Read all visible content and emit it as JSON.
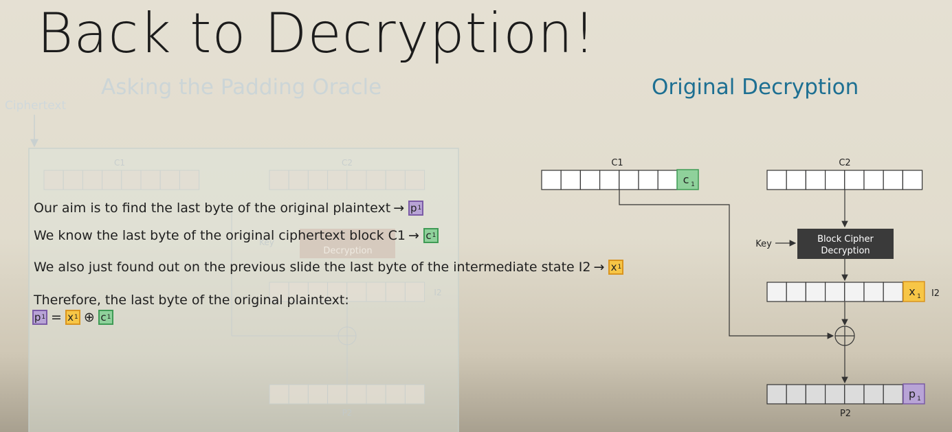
{
  "slide": {
    "title": "Back to Decryption!",
    "heading_left": "Asking the Padding Oracle",
    "heading_right": "Original Decryption",
    "ghost_label": "Ciphertext"
  },
  "ghost_diagram": {
    "c1_label": "C1",
    "c2_label": "C2",
    "key_label": "Key",
    "box_label": "Decryption",
    "i2_label": "I2",
    "p2_label": "P2"
  },
  "diagram": {
    "c1_label": "C1",
    "c2_label": "C2",
    "key_label": "Key",
    "box_line1": "Block Cipher",
    "box_line2": "Decryption",
    "i2_label": "I2",
    "p2_label": "P2",
    "c1_chip": "c",
    "x1_chip": "x",
    "p1_chip": "p",
    "chip_sub": "1",
    "colors": {
      "green_fill": "#8fd19b",
      "green_border": "#3f9b55",
      "orange_fill": "#f7c646",
      "orange_border": "#d9941e",
      "purple_fill": "#b8a4d6",
      "purple_border": "#7b5ba6",
      "box_fill": "#3a3a3a",
      "heading_blue": "#1d6f92"
    }
  },
  "text_lines": {
    "line1": "Our aim is to find the last byte of the original plaintext",
    "line2": "We know the last byte of the original ciphertext block C1",
    "line3": "We also just found out on the previous slide the last byte of the intermediate state I2",
    "line4": "Therefore, the last byte of the original plaintext:",
    "arrow": "→",
    "equals": "=",
    "xor": "⊕",
    "p_chip": "p",
    "c_chip": "c",
    "x_chip": "x",
    "chip_sub": "1"
  }
}
